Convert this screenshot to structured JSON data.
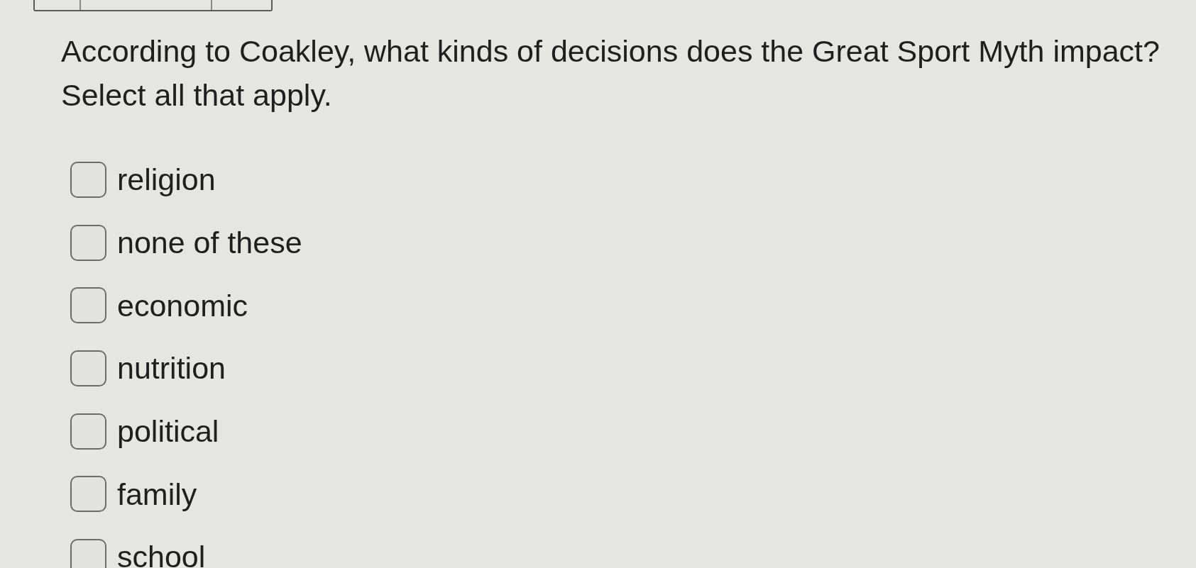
{
  "question": {
    "text": "According to Coakley, what kinds of decisions does the Great Sport Myth impact?",
    "instruction": "Select all that apply."
  },
  "options": [
    {
      "label": "religion",
      "checked": false
    },
    {
      "label": "none of these",
      "checked": false
    },
    {
      "label": "economic",
      "checked": false
    },
    {
      "label": "nutrition",
      "checked": false
    },
    {
      "label": "political",
      "checked": false
    },
    {
      "label": "family",
      "checked": false
    },
    {
      "label": "school",
      "checked": false
    }
  ]
}
